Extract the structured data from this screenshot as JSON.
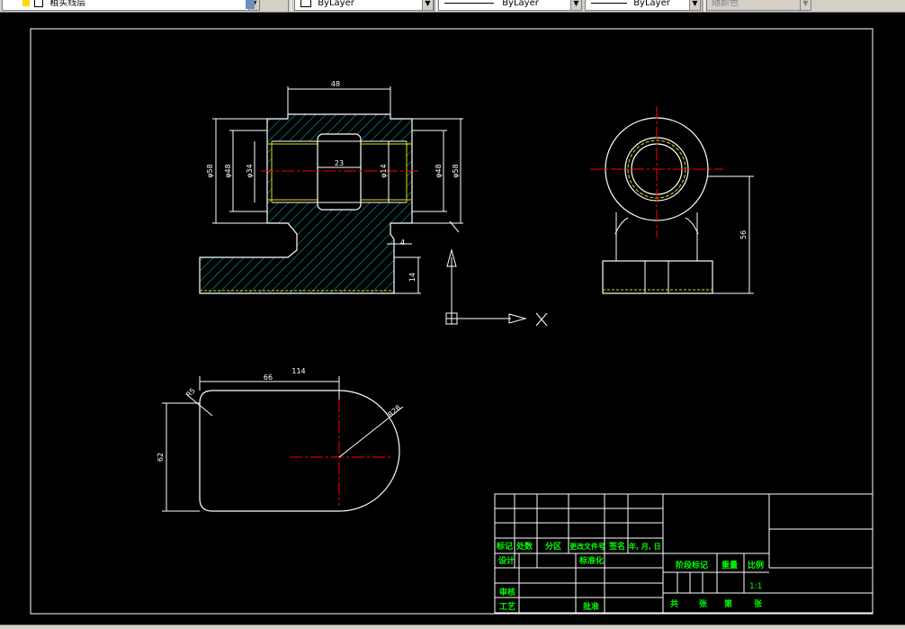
{
  "toolbar": {
    "layer_name": "粗实线层",
    "color_value": "ByLayer",
    "linetype_value": "ByLayer",
    "lineweight_value": "ByLayer",
    "plotstyle_value": "随颜色"
  },
  "drawing": {
    "front_view": {
      "dim_top_width": "48",
      "dim_left_outer": "φ58",
      "dim_left_mid": "φ48",
      "dim_left_inner": "φ34",
      "dim_center": "23",
      "dim_right_inner": "φ14",
      "dim_right_mid": "φ48",
      "dim_right_outer": "φ58",
      "dim_base_height": "14",
      "dim_side": "4"
    },
    "side_view": {
      "dim_height": "56"
    },
    "top_view": {
      "dim_length": "66",
      "dim_total": "114",
      "dim_corner": "R5",
      "dim_radius": "R28",
      "dim_width": "62"
    },
    "ucs_icon": {
      "x_label": "X"
    }
  },
  "title_block": {
    "row_headers": [
      "标记",
      "处数",
      "分区",
      "更改文件号",
      "签名",
      "年, 月, 日"
    ],
    "design": "设计",
    "standardize": "标准化",
    "stage_mark": "阶段标记",
    "weight": "重量",
    "scale_label": "比例",
    "scale_value": "1:1",
    "review": "审核",
    "process": "工艺",
    "approve": "批准",
    "total": "共",
    "sheets_1": "张",
    "page": "第",
    "sheets_2": "张"
  }
}
